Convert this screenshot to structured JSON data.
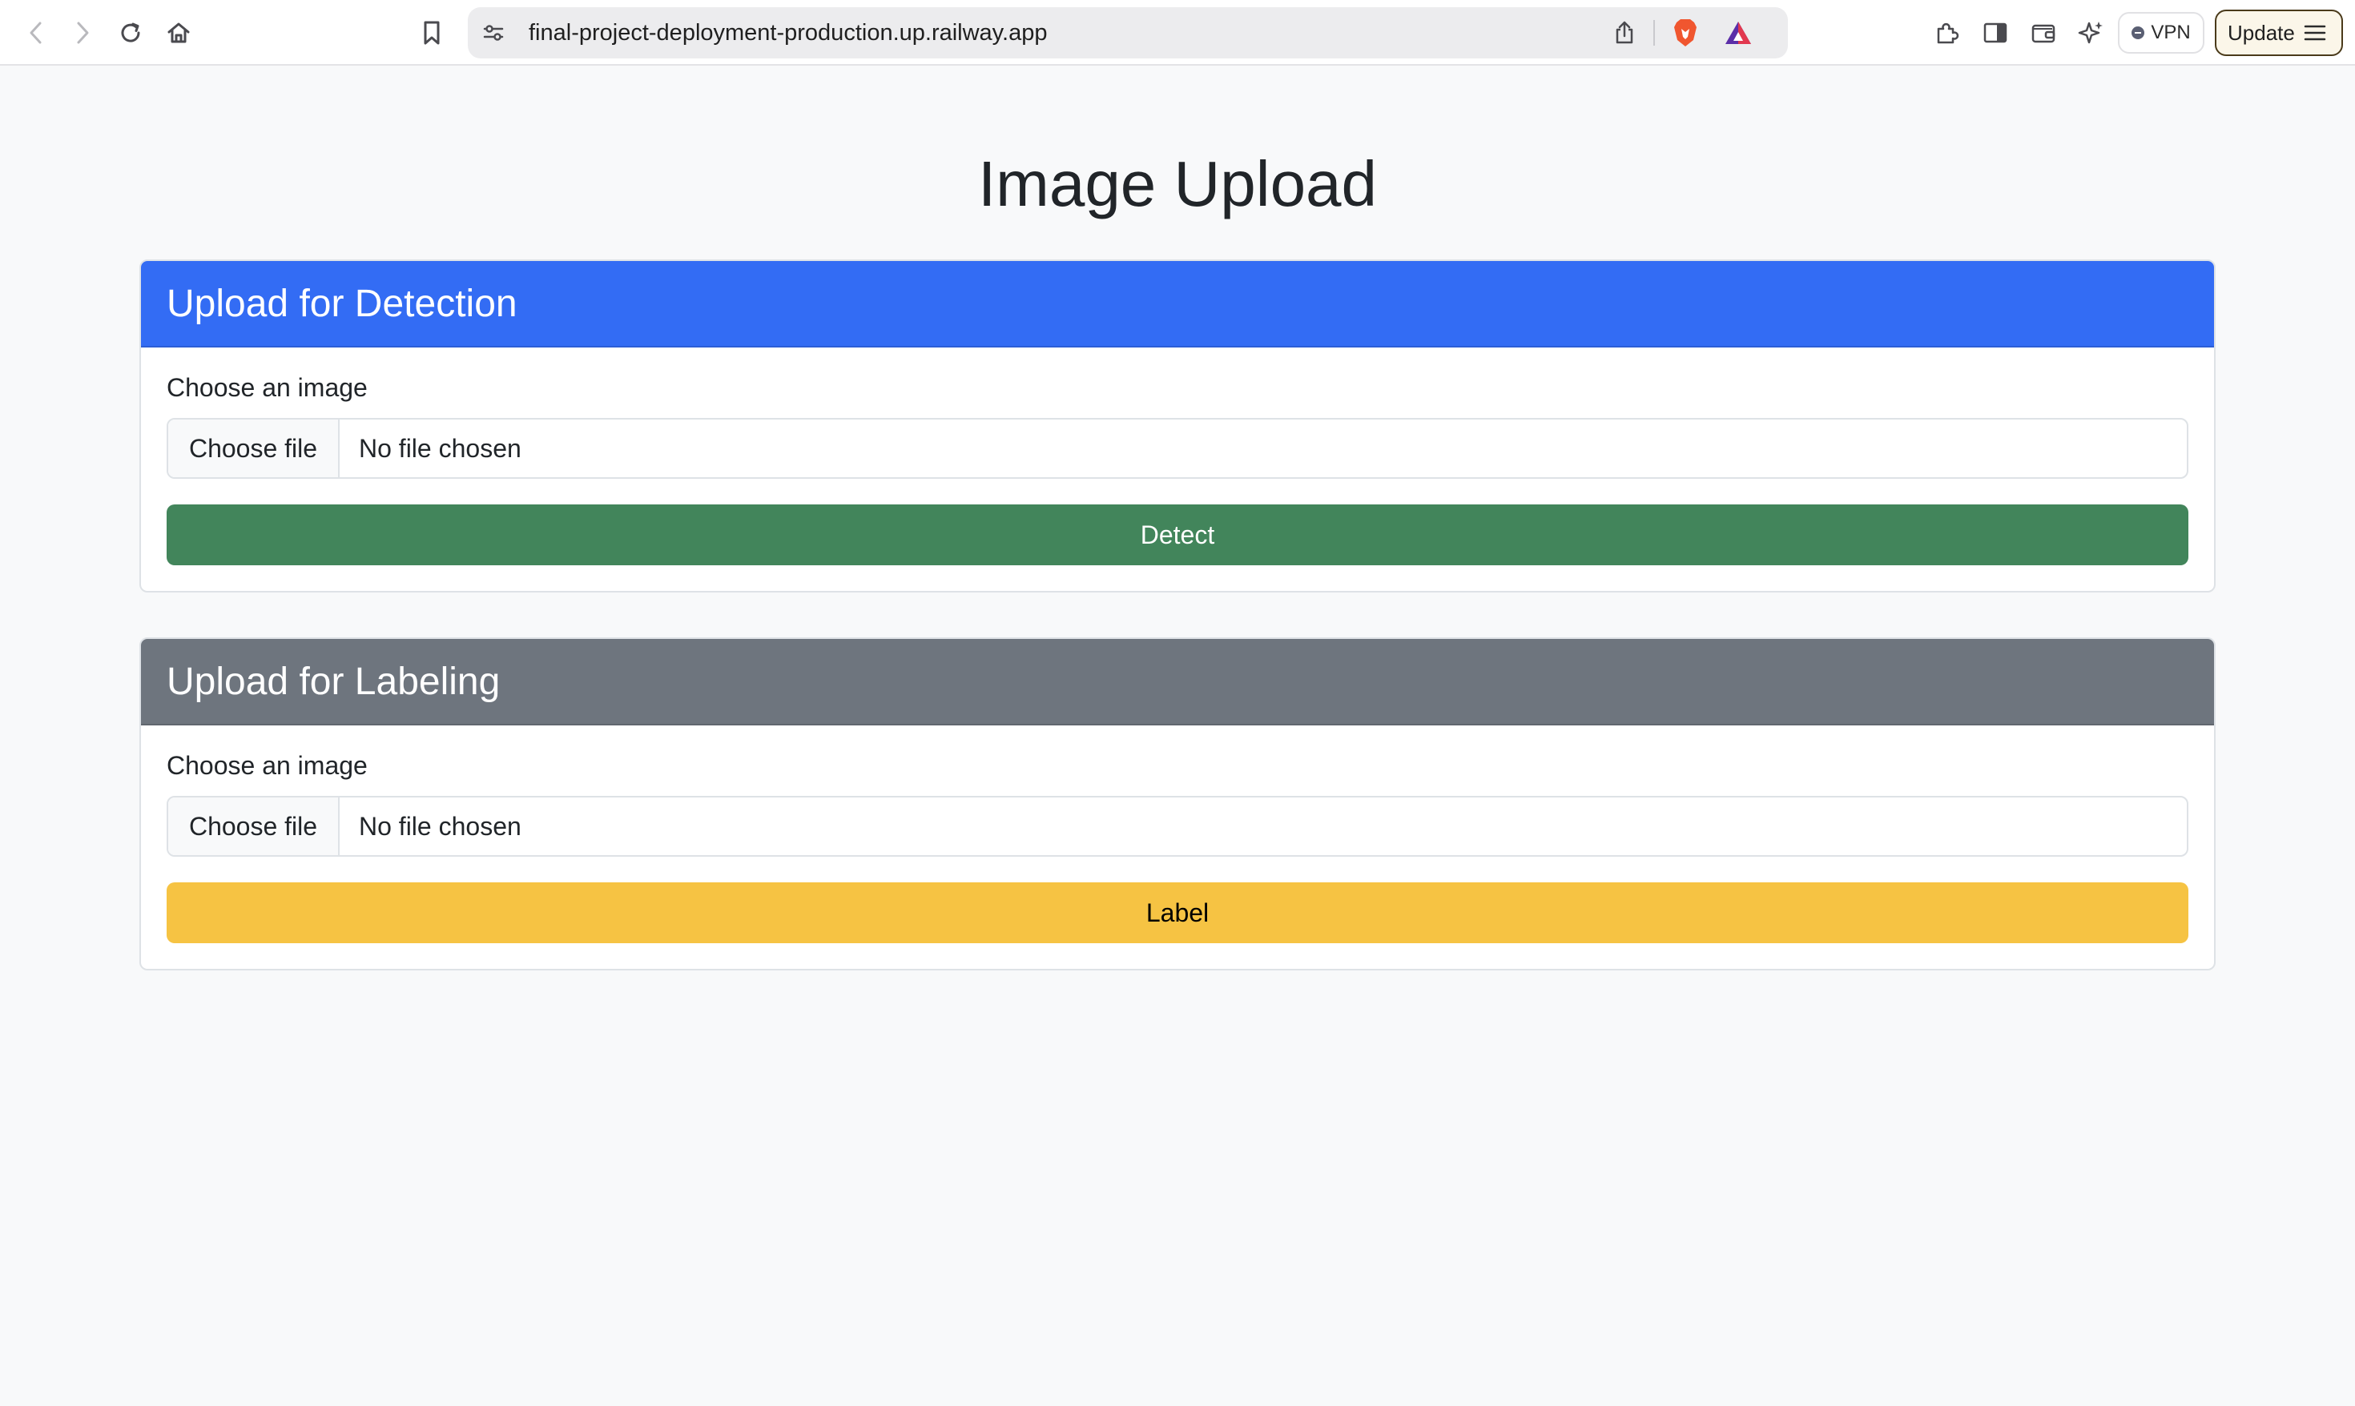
{
  "browser": {
    "url": "final-project-deployment-production.up.railway.app",
    "vpn_label": "VPN",
    "update_label": "Update"
  },
  "page": {
    "title": "Image Upload"
  },
  "detection_card": {
    "header": "Upload for Detection",
    "header_color": "#336cf4",
    "field_label": "Choose an image",
    "file_button": "Choose file",
    "file_status": "No file chosen",
    "submit_label": "Detect",
    "submit_color": "#42855b"
  },
  "labeling_card": {
    "header": "Upload for Labeling",
    "header_color": "#6e757e",
    "field_label": "Choose an image",
    "file_button": "Choose file",
    "file_status": "No file chosen",
    "submit_label": "Label",
    "submit_color": "#f6c343"
  }
}
